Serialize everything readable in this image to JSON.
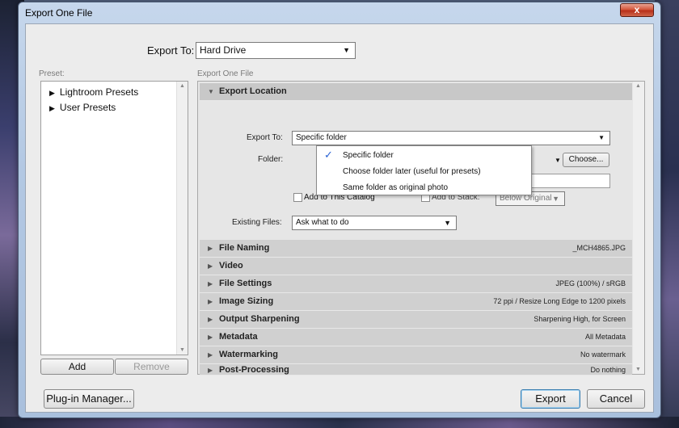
{
  "window": {
    "title": "Export One File",
    "close_label": "x"
  },
  "top": {
    "export_to_label": "Export To:",
    "export_to_value": "Hard Drive"
  },
  "preset": {
    "label": "Preset:",
    "items": [
      {
        "label": "Lightroom Presets"
      },
      {
        "label": "User Presets"
      }
    ],
    "add_label": "Add",
    "remove_label": "Remove"
  },
  "right": {
    "label": "Export One File",
    "location": {
      "title": "Export Location",
      "export_to_label": "Export To:",
      "export_to_value": "Specific folder",
      "folder_label": "Folder:",
      "choose_label": "Choose...",
      "add_catalog_label": "Add to This Catalog",
      "add_stack_label": "Add to Stack:",
      "below_original": "Below Original",
      "existing_files_label": "Existing Files:",
      "existing_files_value": "Ask what to do",
      "dropdown_options": [
        {
          "label": "Specific folder",
          "checked": true
        },
        {
          "label": "Choose folder later (useful for presets)",
          "checked": false
        },
        {
          "label": "Same folder as original photo",
          "checked": false
        }
      ]
    },
    "sections": [
      {
        "title": "File Naming",
        "summary": "_MCH4865.JPG"
      },
      {
        "title": "Video",
        "summary": ""
      },
      {
        "title": "File Settings",
        "summary": "JPEG (100%) / sRGB"
      },
      {
        "title": "Image Sizing",
        "summary": "72 ppi / Resize Long Edge to 1200 pixels"
      },
      {
        "title": "Output Sharpening",
        "summary": "Sharpening High, for Screen"
      },
      {
        "title": "Metadata",
        "summary": "All Metadata"
      },
      {
        "title": "Watermarking",
        "summary": "No watermark"
      },
      {
        "title": "Post-Processing",
        "summary": "Do nothing"
      }
    ]
  },
  "footer": {
    "plugin_label": "Plug-in Manager...",
    "export_label": "Export",
    "cancel_label": "Cancel"
  }
}
